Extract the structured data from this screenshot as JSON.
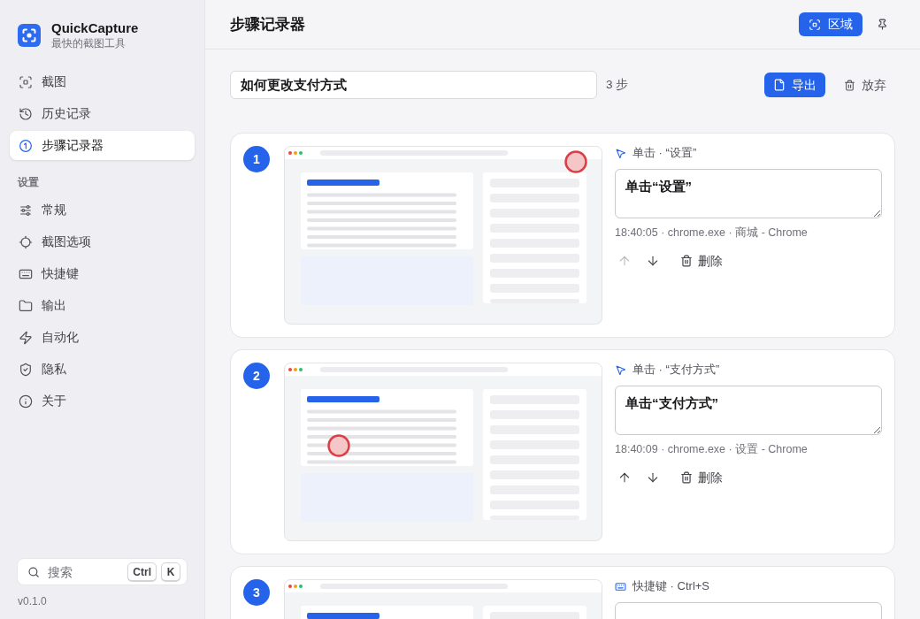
{
  "sidebar": {
    "app_name": "QuickCapture",
    "tagline": "最快的截图工具",
    "nav": [
      {
        "label": "截图",
        "selected": false
      },
      {
        "label": "历史记录",
        "selected": false
      },
      {
        "label": "步骤记录器",
        "selected": true
      }
    ],
    "settings_heading": "设置",
    "settings": [
      {
        "label": "常规",
        "selected": false
      },
      {
        "label": "截图选项",
        "selected": false
      },
      {
        "label": "快捷键",
        "selected": false
      },
      {
        "label": "输出",
        "selected": false
      },
      {
        "label": "自动化",
        "selected": false
      },
      {
        "label": "隐私",
        "selected": false
      },
      {
        "label": "关于",
        "selected": false
      }
    ],
    "search": {
      "placeholder": "搜索",
      "keys": [
        "Ctrl",
        "K"
      ]
    },
    "version": "v0.1.0"
  },
  "header": {
    "title": "步骤记录器",
    "region_button": "区域"
  },
  "toolbar": {
    "guide_title": "如何更改支付方式",
    "step_count": "3 步",
    "export_button": "导出",
    "discard_button": "放弃"
  },
  "steps": [
    {
      "number": "1",
      "kind": "click",
      "action": "单击 · “设置”",
      "marker": {
        "kind": "corner"
      },
      "description": "单击“设置”",
      "meta": "18:40:05 · chrome.exe · 商城 - Chrome",
      "up_disabled": true,
      "down_disabled": false,
      "delete_label": "删除"
    },
    {
      "number": "2",
      "kind": "click",
      "action": "单击 · “支付方式”",
      "marker": {
        "kind": "list-row"
      },
      "description": "单击“支付方式”",
      "meta": "18:40:09 · chrome.exe · 设置 - Chrome",
      "up_disabled": false,
      "down_disabled": false,
      "delete_label": "删除"
    },
    {
      "number": "3",
      "kind": "shortcut",
      "action": "快捷键 · Ctrl+S"
    }
  ]
}
